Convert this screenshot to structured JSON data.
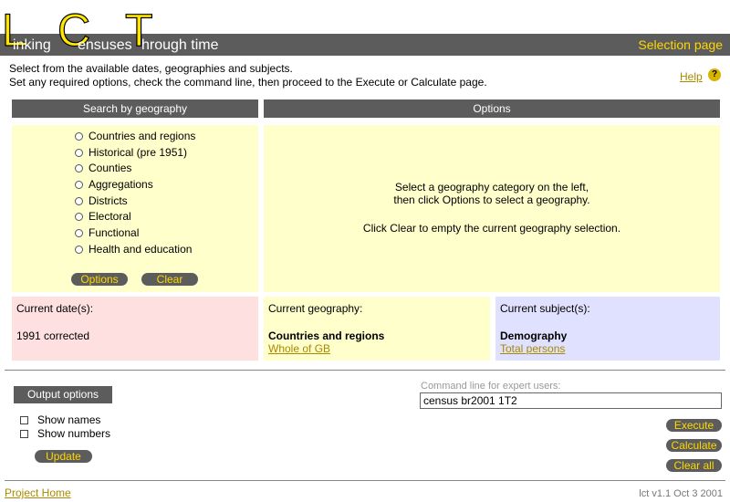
{
  "header": {
    "logo_letters": [
      "L",
      "C",
      "T"
    ],
    "logo_words": [
      "inking",
      "ensuses",
      "hrough time"
    ],
    "page_name": "Selection page"
  },
  "intro": {
    "line1": "Select from the available dates, geographies and subjects.",
    "line2": "Set any required options, check the command line, then proceed to the Execute or Calculate page."
  },
  "help": {
    "label": "Help",
    "icon": "?"
  },
  "geography_panel": {
    "title": "Search by geography",
    "options": [
      "Countries and regions",
      "Historical (pre 1951)",
      "Counties",
      "Aggregations",
      "Districts",
      "Electoral",
      "Functional",
      "Health and education"
    ],
    "options_button": "Options",
    "clear_button": "Clear"
  },
  "options_panel": {
    "title": "Options",
    "line1": "Select a geography category on the left,",
    "line2": "then click Options to select a geography.",
    "line3": "Click Clear to empty the current geography selection."
  },
  "current": {
    "dates_label": "Current date(s):",
    "dates_value": "1991 corrected",
    "geography_label": "Current geography:",
    "geography_value": "Countries and regions",
    "geography_link": "Whole of GB",
    "subject_label": "Current subject(s):",
    "subject_value": "Demography",
    "subject_link": "Total persons"
  },
  "output_options": {
    "title": "Output options",
    "show_names": "Show names",
    "show_numbers": "Show numbers",
    "update_button": "Update"
  },
  "command": {
    "label": "Command line for expert users:",
    "value": "census br2001 1T2"
  },
  "actions": {
    "execute": "Execute",
    "calculate": "Calculate",
    "clear_all": "Clear all"
  },
  "footer": {
    "home_link": "Project Home",
    "version": "lct v1.1 Oct 3 2001"
  },
  "colors": {
    "bar": "#5c5c5c",
    "accent": "#ffd700",
    "yellow_panel": "#ffffcc",
    "pink_panel": "#ffe0e0",
    "blue_panel": "#e0e0ff"
  }
}
